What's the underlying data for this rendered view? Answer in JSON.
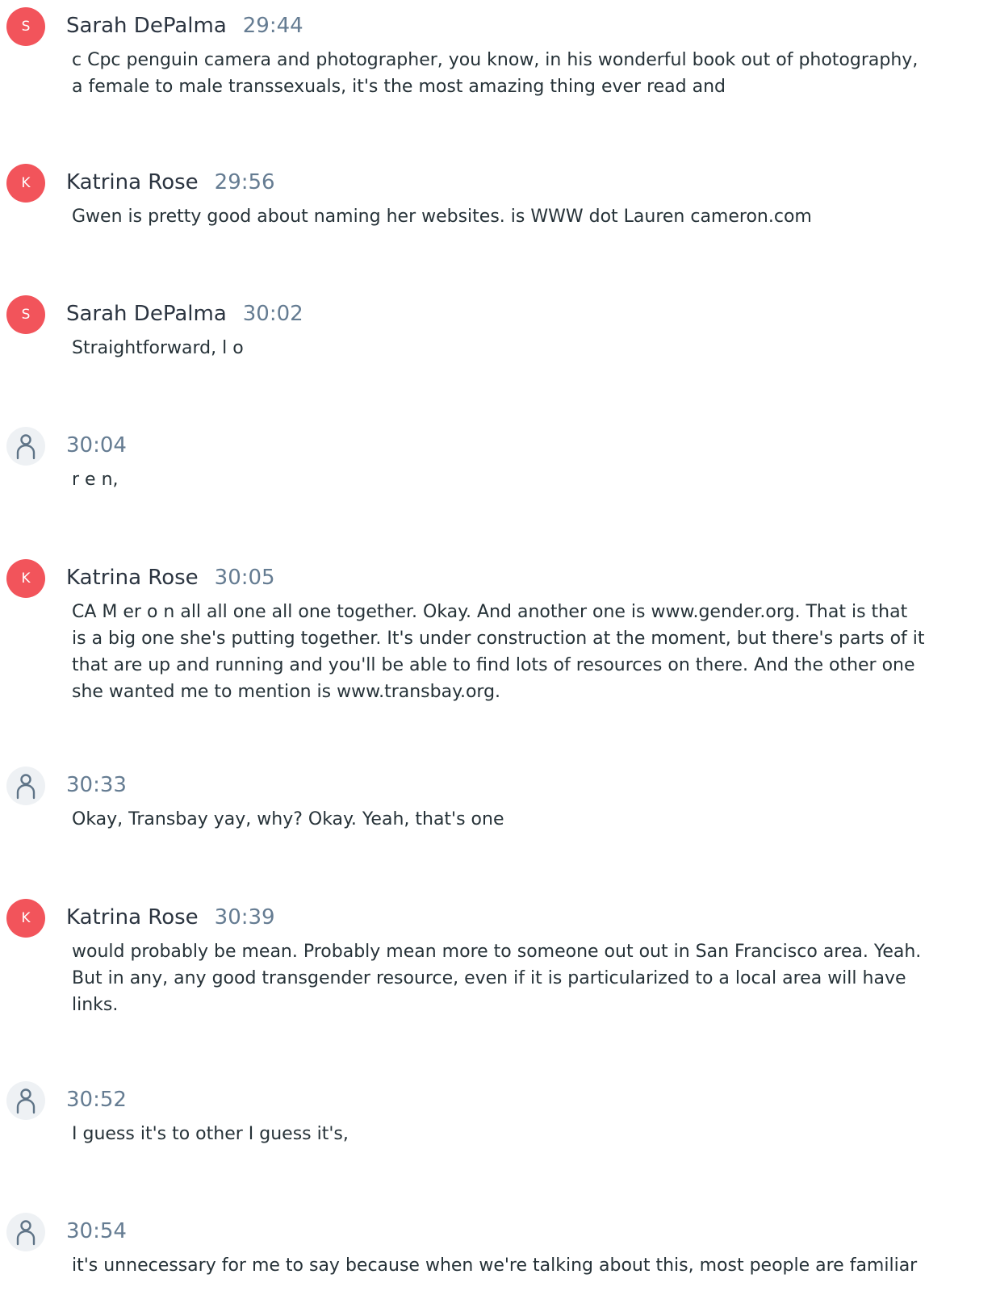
{
  "entries": [
    {
      "speaker": "Sarah DePalma",
      "initial": "S",
      "time": "29:44",
      "lines": [
        "c Cpc penguin camera and photographer, you know, in his wonderful book out of photography,",
        "a female to male transsexuals, it's the most amazing thing ever read and"
      ]
    },
    {
      "speaker": "Katrina Rose",
      "initial": "K",
      "time": "29:56",
      "lines": [
        "Gwen is pretty good about naming her websites. is WWW dot Lauren cameron.com"
      ]
    },
    {
      "speaker": "Sarah DePalma",
      "initial": "S",
      "time": "30:02",
      "lines": [
        "Straightforward, l o"
      ]
    },
    {
      "speaker": "",
      "initial": "",
      "time": "30:04",
      "lines": [
        "r e n,"
      ]
    },
    {
      "speaker": "Katrina Rose",
      "initial": "K",
      "time": "30:05",
      "lines": [
        "CA M er o n all all one all one together. Okay. And another one is www.gender.org. That is that",
        "is a big one she's putting together. It's under construction at the moment, but there's parts of it",
        "that are up and running and you'll be able to find lots of resources on there. And the other one",
        "she wanted me to mention is www.transbay.org."
      ]
    },
    {
      "speaker": "",
      "initial": "",
      "time": "30:33",
      "lines": [
        "Okay, Transbay yay, why? Okay. Yeah, that's one"
      ]
    },
    {
      "speaker": "Katrina Rose",
      "initial": "K",
      "time": "30:39",
      "lines": [
        "would probably be mean. Probably mean more to someone out out in San Francisco area. Yeah.",
        "But in any, any good transgender resource, even if it is particularized to a local area will have",
        "links."
      ]
    },
    {
      "speaker": "",
      "initial": "",
      "time": "30:52",
      "lines": [
        "I guess it's to other I guess it's,"
      ]
    },
    {
      "speaker": "",
      "initial": "",
      "time": "30:54",
      "lines": [
        "it's unnecessary for me to say because when we're talking about this, most people are familiar"
      ]
    }
  ],
  "colors": {
    "avatar_accent": "#f2545b",
    "anonymous_avatar_bg": "#eef1f4",
    "timestamp": "#657c92",
    "speaker_name": "#2b3440",
    "body_text": "#263238"
  },
  "icons": {
    "anonymous_avatar": "user-icon"
  }
}
